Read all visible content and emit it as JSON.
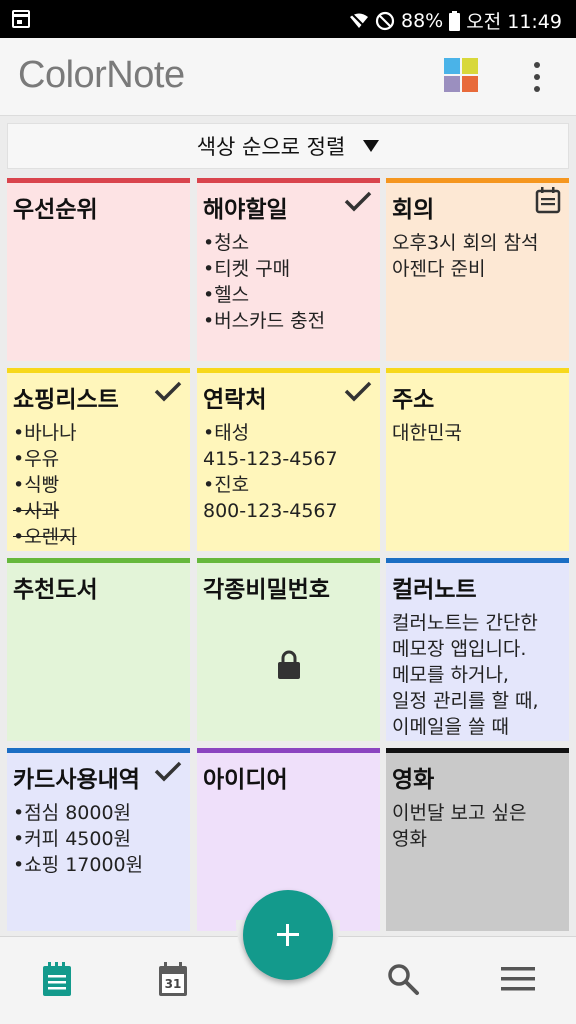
{
  "status_bar": {
    "battery": "88%",
    "time": "오전 11:49"
  },
  "app_bar": {
    "logo": "ColorNote",
    "palette_colors": [
      "#4ab3e8",
      "#d8d83a",
      "#9b8fbf",
      "#e86a3a"
    ]
  },
  "sort": {
    "label": "색상 순으로 정렬"
  },
  "notes": [
    {
      "title": "우선순위",
      "lines": [],
      "color_bar": "#d9444d",
      "bg": "#fde3e4",
      "check": false
    },
    {
      "title": "해야할일",
      "lines": [
        "•청소",
        "•티켓 구매",
        "•헬스",
        "•버스카드 충전"
      ],
      "color_bar": "#d9444d",
      "bg": "#fde3e4",
      "check": true
    },
    {
      "title": "회의",
      "lines": [
        "오후3시 회의 참석",
        "아젠다 준비"
      ],
      "color_bar": "#f5961f",
      "bg": "#fde8d4",
      "calendar": true
    },
    {
      "title": "쇼핑리스트",
      "lines": [
        "•바나나",
        "•우유",
        "•식빵",
        "•사과",
        "•오렌지"
      ],
      "struck": [
        3,
        4
      ],
      "color_bar": "#f7d81c",
      "bg": "#fff6bb",
      "check": true
    },
    {
      "title": "연락처",
      "lines": [
        "•태성",
        "415-123-4567",
        "•진호",
        "800-123-4567"
      ],
      "color_bar": "#f7d81c",
      "bg": "#fff6bb",
      "check": true
    },
    {
      "title": "주소",
      "lines": [
        "대한민국"
      ],
      "color_bar": "#f7d81c",
      "bg": "#fff6bb"
    },
    {
      "title": "추천도서",
      "lines": [],
      "color_bar": "#66b83c",
      "bg": "#e3f4d8"
    },
    {
      "title": "각종비밀번호",
      "lines": [],
      "color_bar": "#66b83c",
      "bg": "#e3f4d8",
      "locked": true
    },
    {
      "title": "컬러노트",
      "lines": [
        "컬러노트는 간단한",
        "메모장 앱입니다.",
        "메모를 하거나,",
        "일정 관리를 할 때,",
        "이메일을 쓸 때"
      ],
      "color_bar": "#1b6ec4",
      "bg": "#e4e6fb"
    },
    {
      "title": "카드사용내역",
      "lines": [
        "•점심 8000원",
        "•커피 4500원",
        "•쇼핑 17000원"
      ],
      "color_bar": "#1b6ec4",
      "bg": "#e4e6fb",
      "check": true
    },
    {
      "title": "아이디어",
      "lines": [],
      "color_bar": "#8b44c0",
      "bg": "#efe0fa"
    },
    {
      "title": "영화",
      "lines": [
        "이번달 보고 싶은",
        "영화"
      ],
      "color_bar": "#111111",
      "bg": "#c9c9c9"
    }
  ],
  "bottom_nav": {
    "calendar_day": "31",
    "accent": "#139a8c"
  }
}
